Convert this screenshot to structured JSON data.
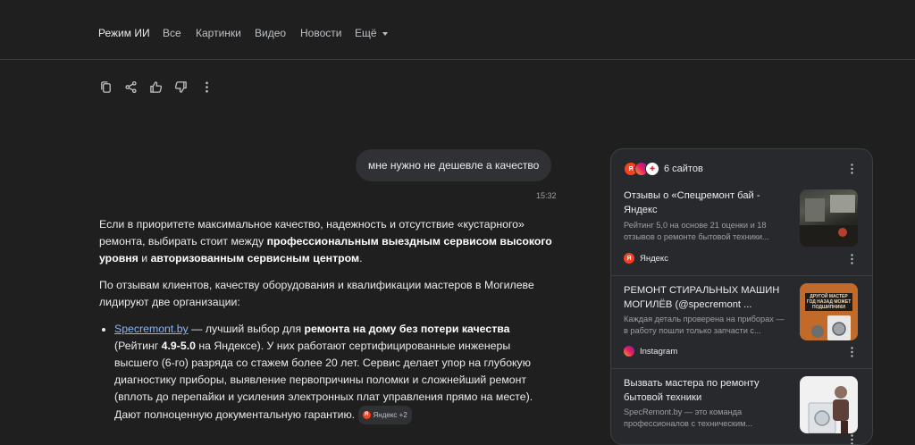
{
  "nav": {
    "tabs": [
      "Режим ИИ",
      "Все",
      "Картинки",
      "Видео",
      "Новости",
      "Ещё"
    ]
  },
  "toolbar": {
    "icons": [
      "copy-icon",
      "share-icon",
      "thumbs-up-icon",
      "thumbs-down-icon",
      "more-vert-icon"
    ]
  },
  "chat": {
    "user_message": "мне нужно не дешевле а качество",
    "time": "15:32"
  },
  "answer": {
    "p1_a": "Если в приоритете максимальное качество, надежность и отсутствие «кустарного» ремонта, выбирать стоит между ",
    "p1_b1": "профессиональным выездным сервисом высокого уровня",
    "p1_c": " и ",
    "p1_b2": "авторизованным сервисным центром",
    "p1_d": ".",
    "p2": "По отзывам клиентов, качеству оборудования и квалификации мастеров в Могилеве лидируют две организации:",
    "li_link": "Specremont.by",
    "li_a": " — лучший выбор для ",
    "li_b1": "ремонта на дому без потери качества",
    "li_c": " (Рейтинг ",
    "li_b2": "4.9-5.0",
    "li_d": " на Яндексе). У них работают сертифицированные инженеры высшего (6-го) разряда со стажем более 20 лет. Сервис делает упор на глубокую диагностику приборы, выявление первопричины поломки и сложнейший ремонт (вплоть до перепайки и усиления электронных плат управления прямо на месте). Дают полноценную документальную гарантию.",
    "chip": "Яндекс +2"
  },
  "sources": {
    "count_label": "6 сайтов",
    "cards": [
      {
        "title": "Отзывы о «Спецремонт бай - Яндекс",
        "desc": "Рейтинг 5,0 на основе 21 оценки и 18 отзывов о ремонте бытовой техники...",
        "source": "Яндекс",
        "source_icon": "yandex-icon"
      },
      {
        "title": "РЕМОНТ СТИРАЛЬНЫХ МАШИН МОГИЛЁВ (@specremont ...",
        "desc": "Каждая деталь проверена на приборах — в работу пошли только запчасти с...",
        "source": "Instagram",
        "source_icon": "instagram-icon",
        "thumb_text": "ДРУГОЙ МАСТЕР ГОД НАЗАД МОЖЕТ ПОДШИПНИКИ"
      },
      {
        "title": "Вызвать мастера по ремонту бытовой техники",
        "desc": "SpecRemont.by — это команда профессионалов с техническим...",
        "source": "",
        "source_icon": ""
      }
    ]
  },
  "colors": {
    "background": "#1f1f1f",
    "panel": "#28292c",
    "link": "#8ab4f8",
    "yandex": "#fc3f1d"
  }
}
